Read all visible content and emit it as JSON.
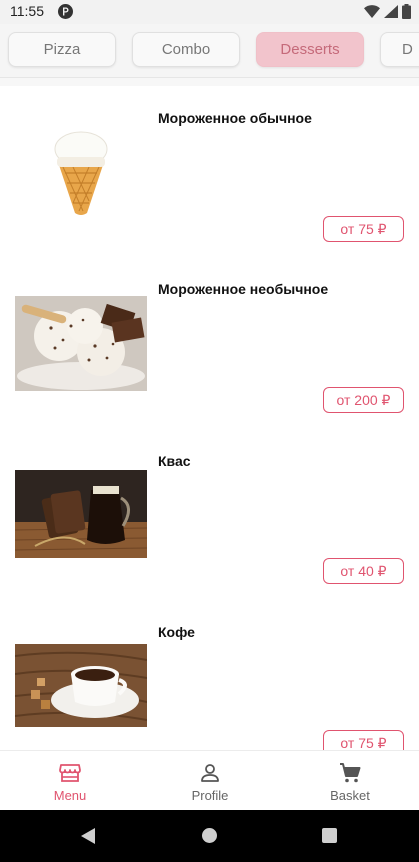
{
  "status_bar": {
    "time": "11:55",
    "icons": [
      "app-notification-icon",
      "wifi-icon",
      "signal-icon",
      "battery-icon"
    ]
  },
  "categories": {
    "tabs": [
      {
        "label": "Pizza",
        "active": false
      },
      {
        "label": "Combo",
        "active": false
      },
      {
        "label": "Desserts",
        "active": true
      },
      {
        "label": "D",
        "active": false
      }
    ]
  },
  "products": [
    {
      "name": "Мороженное обычное",
      "price": "от 75 ₽",
      "image": "ice-cream-cone"
    },
    {
      "name": "Мороженное необычное",
      "price": "от 200 ₽",
      "image": "ice-cream-bowl"
    },
    {
      "name": "Квас",
      "price": "от 40 ₽",
      "image": "kvass-jug-and-bread"
    },
    {
      "name": "Кофе",
      "price": "от 75 ₽",
      "image": "coffee-cup"
    }
  ],
  "bottom_nav": {
    "items": [
      {
        "label": "Menu",
        "icon": "store-icon",
        "active": true
      },
      {
        "label": "Profile",
        "icon": "person-icon",
        "active": false
      },
      {
        "label": "Basket",
        "icon": "cart-icon",
        "active": false
      }
    ]
  },
  "colors": {
    "accent": "#e0546f",
    "active_tab_bg": "#f2c4cc",
    "active_tab_text": "#c56a7a"
  }
}
